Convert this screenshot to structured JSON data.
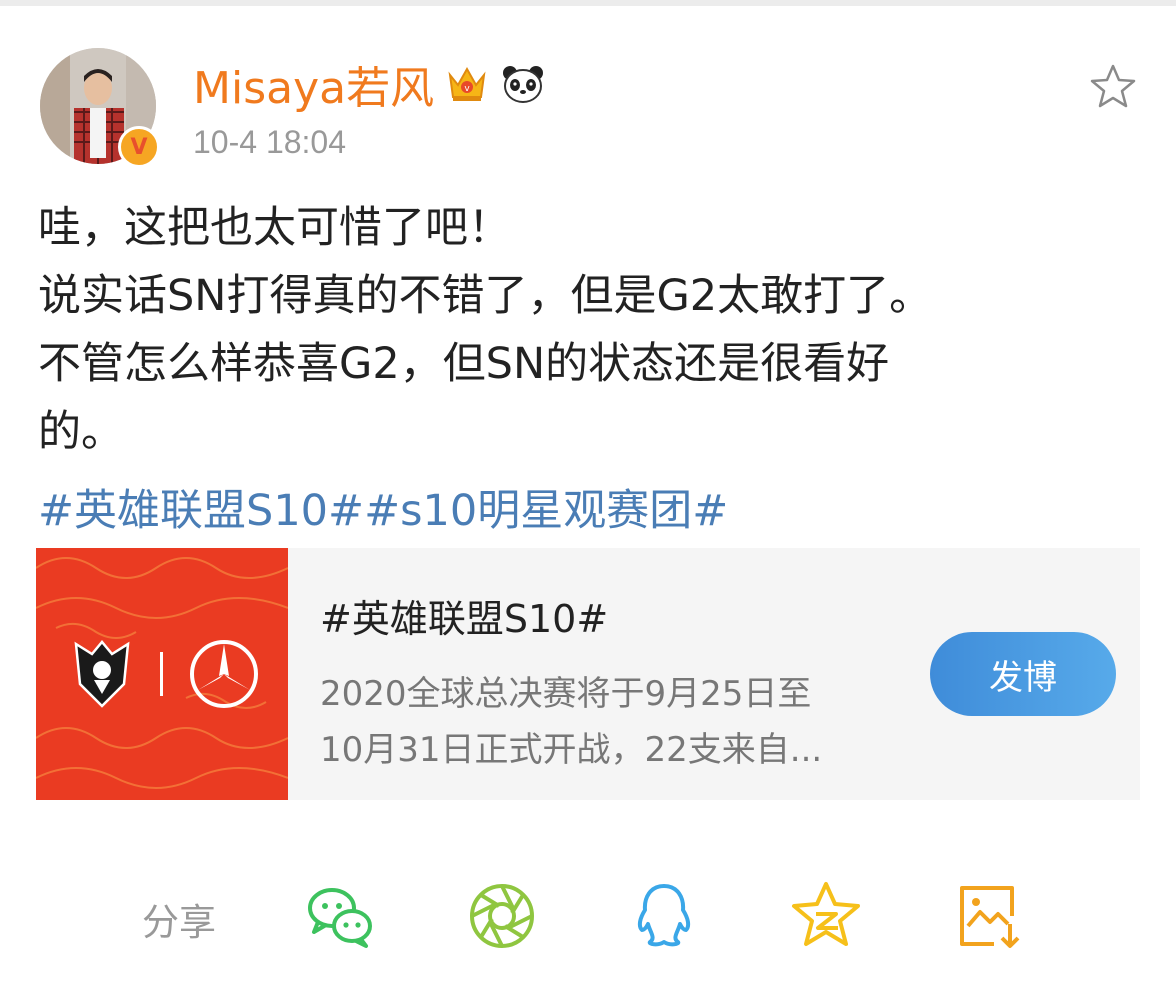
{
  "header": {
    "username": "Misaya若风",
    "timestamp": "10-4 18:04",
    "verified_badge": "V"
  },
  "post": {
    "lines": [
      "哇，这把也太可惜了吧！",
      "说实话SN打得真的不错了，但是G2太敢打了。",
      "不管怎么样恭喜G2，但SN的状态还是很看好",
      "的。"
    ],
    "hashtags": [
      "#英雄联盟S10#",
      "#s10明星观赛团#"
    ]
  },
  "topic_card": {
    "title": "#英雄联盟S10#",
    "description_lines": [
      "2020全球总决赛将于9月25日至",
      "10月31日正式开战，22支来自..."
    ],
    "button_label": "发博"
  },
  "share": {
    "label": "分享",
    "targets": [
      "wechat-icon",
      "moments-icon",
      "qq-icon",
      "qzone-icon",
      "save-image-icon"
    ]
  },
  "icons": {
    "crown": "crown-icon",
    "panda": "panda-icon",
    "favorite": "star-outline-icon"
  },
  "colors": {
    "username": "#f07a1e",
    "hashtag": "#4a7db5",
    "button": "#4a9be4",
    "wechat": "#3dc25e",
    "moments": "#8fc640",
    "qq": "#3aa7e8",
    "qzone": "#f6c01a",
    "save": "#f2a31d"
  }
}
